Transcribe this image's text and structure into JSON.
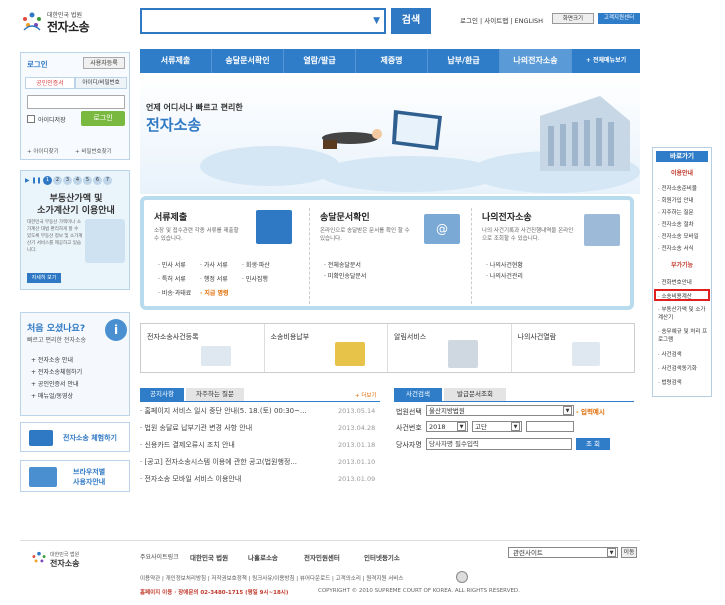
{
  "header": {
    "logo_small": "대한민국 법원",
    "logo_big": "전자소송",
    "search_button": "검색",
    "util_links": "로그인 | 사이트맵 | ENGLISH",
    "font_zoom": "화면크기",
    "help_center": "고객지원센터"
  },
  "gnb": [
    "서류제출",
    "송달문서확인",
    "열람/발급",
    "제증명",
    "납부/환급",
    "나의전자소송",
    "+ 전체메뉴보기"
  ],
  "login": {
    "tab_login": "로그인",
    "tab_register": "사용자등록",
    "tab_cert": "공인인증서",
    "tab_idpw": "아이디/비밀번호",
    "save_id": "아이디저장",
    "login_button": "로그인",
    "find_id": "+ 아이디찾기",
    "find_pw": "+ 비밀번호찾기"
  },
  "banner": {
    "pager": [
      "1",
      "2",
      "3",
      "4",
      "5",
      "6",
      "7"
    ],
    "title1": "부동산가액 및",
    "title2": "소가계산기 이용안내",
    "desc": "대한민국 부동산 가액이나 소가계산 대법 편리하게 할 수 있도록 부동산 정보 및 소가계산기 서비스를 제공하고 있습니다.",
    "button": "자세히 보기"
  },
  "hero": {
    "line1": "언제 어디서나 빠르고 편리한",
    "line2": "전자소송"
  },
  "services": [
    {
      "title": "서류제출",
      "desc": "소장 및 접수관련 각종 서류를 제출할 수 있습니다.",
      "items": [
        "· 민사 서류",
        "· 가사 서류",
        "· 회생·파산",
        "· 특허 서류",
        "· 행정 서류",
        "· 민사집행",
        "· 비송·과태료",
        "· 지급 명령"
      ]
    },
    {
      "title": "송달문서확인",
      "desc": "온라인으로 송달받은 문서를 확인 할 수 있습니다.",
      "items": [
        "· 전체송달문서",
        "· 미확인송달문서"
      ]
    },
    {
      "title": "나의전자소송",
      "desc": "나의 사건기록과 사건진행내역을 온라인으로 조회할 수 있습니다.",
      "items": [
        "· 나의사건현황",
        "· 나의사건관리"
      ]
    }
  ],
  "welcome": {
    "title": "처음 오셨나요?",
    "sub": "빠르고 편리한 전자소송",
    "links": [
      "+ 전자소송 안내",
      "+ 전자소송체험하기",
      "+ 공인인증서 안내",
      "+ 매뉴얼/동영상"
    ]
  },
  "side_buttons": [
    {
      "label": "전자소송 체험하기"
    },
    {
      "label1": "브라우저별",
      "label2": "사용자안내"
    }
  ],
  "quick": [
    "전자소송사건등록",
    "소송비용납부",
    "알림서비스",
    "나의사건열람"
  ],
  "news": {
    "tabs": [
      "공지사항",
      "자주하는 질문"
    ],
    "more": "+ 더보기",
    "items": [
      {
        "title": "· 홈페이지 서비스 일시 중단 안내(5. 18.(토) 00:30~...",
        "date": "2013.05.14"
      },
      {
        "title": "· 법원 송달료 납부기관 변경 사항 안내",
        "date": "2013.04.28"
      },
      {
        "title": "· 신용카드 결제오류시 조치 안내",
        "date": "2013.01.18"
      },
      {
        "title": "· [공고] 전자소송시스템 이용에 관한 공고(법원행정...",
        "date": "2013.01.10"
      },
      {
        "title": "· 전자소송 모바일 서비스 이용안내",
        "date": "2013.01.09"
      }
    ]
  },
  "case_search": {
    "tabs": [
      "사건검색",
      "발급문서조회"
    ],
    "court_label": "법원선택",
    "court_value": "울산지방법원",
    "required_note": "- 입력예시",
    "case_label": "사건번호",
    "year": "2018",
    "case_type": "고단",
    "party_label": "당사자명",
    "party_placeholder": "당사자명 필수입력",
    "search_button": "조 회"
  },
  "right_quick": {
    "title": "바로가기",
    "section1": "이용안내",
    "items1": [
      "· 전자소송준비물",
      "· 회원가입 안내",
      "· 지주하는 질문",
      "· 전자소송 절차",
      "· 전자소송 모바일",
      "· 전자소송 서식"
    ],
    "section2": "부가기능",
    "items2": [
      "· 전화번호안내",
      "· 소송비용계산",
      "· 부동산가액 및 소가계산기",
      "· 송무예규 및 처리 프로그램",
      "· 사건검색",
      "· 사건검색동기화",
      "· 법령검색"
    ]
  },
  "footer": {
    "related_label": "주요사이트링크",
    "links": [
      "대한민국 법원",
      "나홀로소송",
      "전자민원센터",
      "인터넷등기소"
    ],
    "select": "관련사이트",
    "go": "이동",
    "bottom_links": "이용약관 | 개인정보처리방침 | 저작권보호정책 | 링크사유/이용방침 | 뷰어다운로드 | 고객의소리 | 원격지원 서비스",
    "contact": "홈페이지 이용 · 장애문의 02-3480-1715 (평일 9시~18시)",
    "copyright": "COPYRIGHT © 2010 SUPREME COURT OF KOREA. ALL RIGHTS RESERVED."
  },
  "colors": {
    "primary": "#2f7dc8",
    "accent": "#e03b3b",
    "highlight": "#ff7800"
  }
}
